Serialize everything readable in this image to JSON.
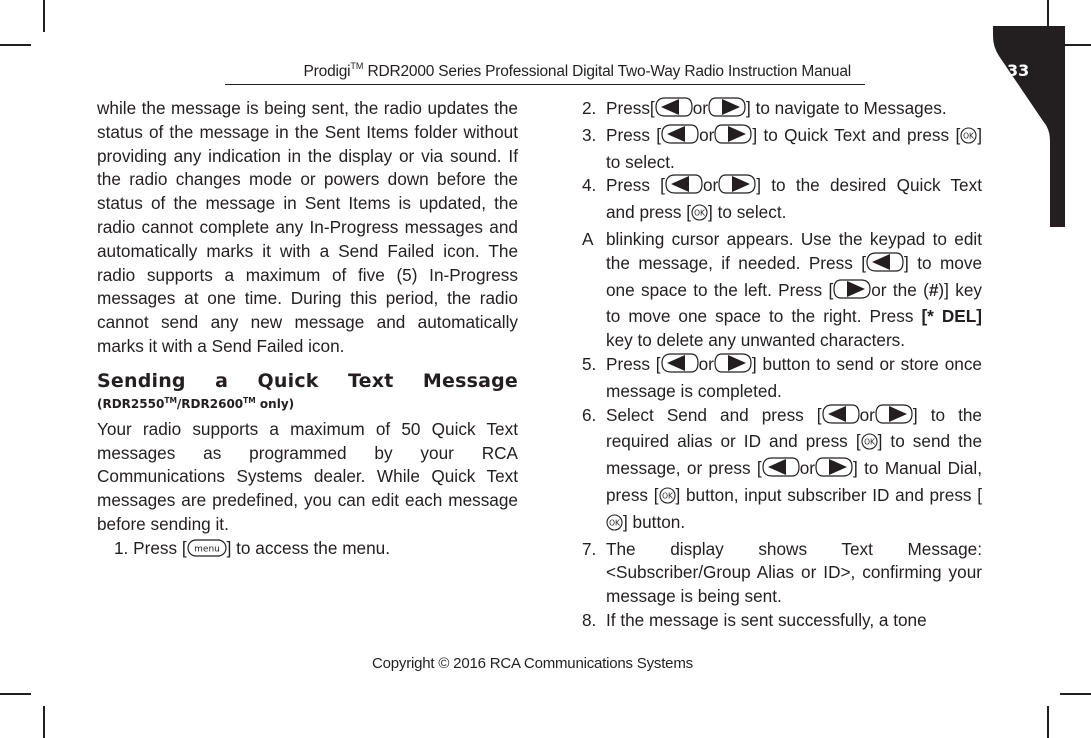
{
  "header": {
    "brand": "Prodigi",
    "brand_tm": "TM",
    "title_rest": " RDR2000 Series Professional Digital Two-Way Radio Instruction Manual"
  },
  "page_number": "33",
  "left_column": {
    "intro_paragraph": "while the message is being sent, the radio updates the status of the message in the Sent Items folder without providing any indication in the display or via sound. If the radio changes mode or powers down before the status of the message in Sent Items is updated, the radio cannot complete any In-Progress messages and automatically marks it with a Send Failed icon. The radio supports a maximum of five (5) In-Progress messages at one time. During this period, the radio cannot send any new message and automatically marks it with a Send Failed icon.",
    "section_heading": "Sending a Quick Text Message",
    "section_subheading": {
      "open": "(RDR2550",
      "tm1": "TM",
      "mid": "/RDR2600",
      "tm2": "TM",
      "close": " only)"
    },
    "body_paragraph": "Your radio supports a maximum of 50 Quick Text messages as programmed by your RCA Communications Systems dealer. While Quick Text messages are predefined, you can edit each message before sending it.",
    "step1": {
      "number": "1.",
      "before": "Press [",
      "icon": "menu-button-icon",
      "after": "] to access the menu."
    }
  },
  "right_column": {
    "steps": [
      {
        "number": "2.",
        "parts": [
          "Press[",
          "{left}",
          "or",
          "{right}",
          "] to navigate to Messages."
        ]
      },
      {
        "number": "3.",
        "parts": [
          "Press [",
          "{left}",
          "or",
          "{right}",
          "] to Quick Text and press [",
          "{ok}",
          "] to select."
        ]
      },
      {
        "number": "4.",
        "parts": [
          "Press [",
          "{left}",
          "or",
          "{right}",
          "] to the desired Quick Text and press [",
          "{ok}",
          "] to select."
        ]
      },
      {
        "number": "A",
        "parts": [
          "blinking cursor appears. Use the keypad to edit the message, if needed. Press [",
          "{left}",
          "] to move one space to the left. Press [",
          "{right}",
          "or the (",
          "#",
          ")] key to move one space to the right. Press ",
          "[* DEL]",
          " key to delete any unwanted characters."
        ]
      },
      {
        "number": "5.",
        "parts": [
          "Press [",
          "{left}",
          "or",
          "{right}",
          "] button to send or store once message is completed."
        ]
      },
      {
        "number": "6.",
        "parts": [
          "Select Send and press [",
          "{left}",
          "or",
          "{right}",
          "] to the required alias or ID and press [",
          "{ok}",
          "] to send the message, or press [",
          "{left}",
          "or",
          "{right}",
          "] to Manual Dial, press [",
          "{ok}",
          "] button, input subscriber ID and press [",
          "{ok}",
          "] button."
        ]
      },
      {
        "number": "7.",
        "parts": [
          "The display shows Text Message: <Subscriber/Group Alias or ID>, confirming your message is being sent."
        ]
      },
      {
        "number": "8.",
        "parts": [
          "If the message is sent successfully, a tone"
        ]
      }
    ],
    "icons": {
      "left": "left-arrow-button-icon",
      "right": "right-arrow-button-icon",
      "ok": "ok-button-icon"
    },
    "bold_parts": [
      "#",
      "[* DEL]"
    ]
  },
  "footer": {
    "copyright": "Copyright © 2016 RCA Communications Systems"
  },
  "icon_labels": {
    "menu": "menu",
    "ok": "OK"
  },
  "colors": {
    "ink": "#231f20",
    "tab_fill": "#231f20",
    "tab_text": "#ffffff"
  }
}
